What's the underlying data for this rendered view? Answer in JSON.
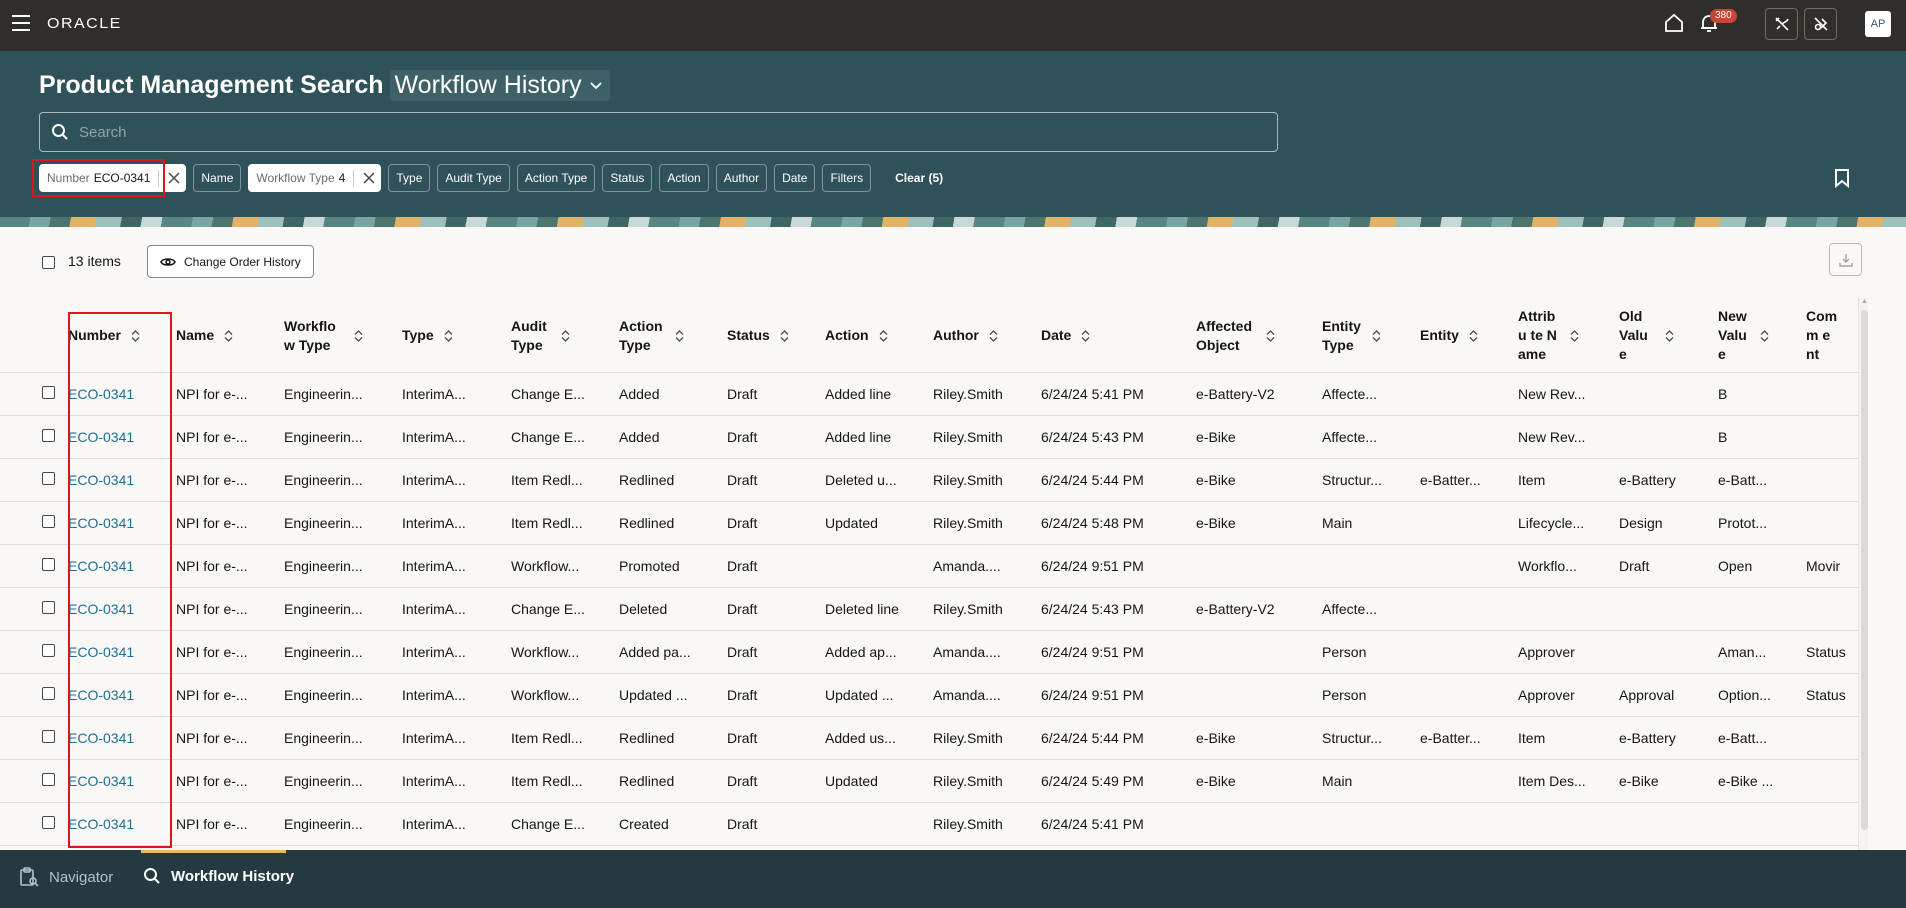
{
  "topbar": {
    "logo": "ORACLE",
    "notification_count": "380",
    "avatar_initials": "AP"
  },
  "header": {
    "title": "Product Management Search",
    "view_switcher": "Workflow History",
    "search_placeholder": "Search",
    "search_value": "",
    "chips": [
      {
        "label": "Number",
        "value": "ECO-0341",
        "active": true
      },
      {
        "label": "Name",
        "active": false
      },
      {
        "label": "Workflow Type",
        "value": "4",
        "active": true
      },
      {
        "label": "Type",
        "active": false
      },
      {
        "label": "Audit Type",
        "active": false
      },
      {
        "label": "Action Type",
        "active": false
      },
      {
        "label": "Status",
        "active": false
      },
      {
        "label": "Action",
        "active": false
      },
      {
        "label": "Author",
        "active": false
      },
      {
        "label": "Date",
        "active": false
      },
      {
        "label": "Filters",
        "active": false
      }
    ],
    "clear_label": "Clear (5)"
  },
  "toolbar": {
    "items_count": "13 items",
    "change_order_history_label": "Change Order History"
  },
  "table": {
    "columns": [
      {
        "key": "number",
        "label": "Number"
      },
      {
        "key": "name",
        "label": "Name"
      },
      {
        "key": "workflow_type",
        "label": "Workflow Type"
      },
      {
        "key": "type",
        "label": "Type"
      },
      {
        "key": "audit_type",
        "label": "Audit Type"
      },
      {
        "key": "action_type",
        "label": "Action Type"
      },
      {
        "key": "status",
        "label": "Status"
      },
      {
        "key": "action",
        "label": "Action"
      },
      {
        "key": "author",
        "label": "Author"
      },
      {
        "key": "date",
        "label": "Date"
      },
      {
        "key": "affected_object",
        "label": "Affected Object"
      },
      {
        "key": "entity_type",
        "label": "Entity Type"
      },
      {
        "key": "entity",
        "label": "Entity"
      },
      {
        "key": "attribute_name",
        "label": "Attribu te Name"
      },
      {
        "key": "old_value",
        "label": "Old Value"
      },
      {
        "key": "new_value",
        "label": "New Valu e"
      },
      {
        "key": "comment",
        "label": "Comm ent"
      }
    ],
    "rows": [
      [
        "ECO-0341",
        "NPI for e-...",
        "Engineerin...",
        "InterimA...",
        "Change E...",
        "Added",
        "Draft",
        "Added line",
        "Riley.Smith",
        "6/24/24 5:41 PM",
        "e-Battery-V2",
        "Affecte...",
        "",
        "New Rev...",
        "",
        "B",
        ""
      ],
      [
        "ECO-0341",
        "NPI for e-...",
        "Engineerin...",
        "InterimA...",
        "Change E...",
        "Added",
        "Draft",
        "Added line",
        "Riley.Smith",
        "6/24/24 5:43 PM",
        "e-Bike",
        "Affecte...",
        "",
        "New Rev...",
        "",
        "B",
        ""
      ],
      [
        "ECO-0341",
        "NPI for e-...",
        "Engineerin...",
        "InterimA...",
        "Item Redl...",
        "Redlined",
        "Draft",
        "Deleted u...",
        "Riley.Smith",
        "6/24/24 5:44 PM",
        "e-Bike",
        "Structur...",
        "e-Batter...",
        "Item",
        "e-Battery",
        "e-Batt...",
        ""
      ],
      [
        "ECO-0341",
        "NPI for e-...",
        "Engineerin...",
        "InterimA...",
        "Item Redl...",
        "Redlined",
        "Draft",
        "Updated",
        "Riley.Smith",
        "6/24/24 5:48 PM",
        "e-Bike",
        "Main",
        "",
        "Lifecycle...",
        "Design",
        "Protot...",
        ""
      ],
      [
        "ECO-0341",
        "NPI for e-...",
        "Engineerin...",
        "InterimA...",
        "Workflow...",
        "Promoted",
        "Draft",
        "",
        "Amanda....",
        "6/24/24 9:51 PM",
        "",
        "",
        "",
        "Workflo...",
        "Draft",
        "Open",
        "Movir"
      ],
      [
        "ECO-0341",
        "NPI for e-...",
        "Engineerin...",
        "InterimA...",
        "Change E...",
        "Deleted",
        "Draft",
        "Deleted line",
        "Riley.Smith",
        "6/24/24 5:43 PM",
        "e-Battery-V2",
        "Affecte...",
        "",
        "",
        "",
        "",
        ""
      ],
      [
        "ECO-0341",
        "NPI for e-...",
        "Engineerin...",
        "InterimA...",
        "Workflow...",
        "Added pa...",
        "Draft",
        "Added ap...",
        "Amanda....",
        "6/24/24 9:51 PM",
        "",
        "Person",
        "",
        "Approver",
        "",
        "Aman...",
        "Status"
      ],
      [
        "ECO-0341",
        "NPI for e-...",
        "Engineerin...",
        "InterimA...",
        "Workflow...",
        "Updated ...",
        "Draft",
        "Updated ...",
        "Amanda....",
        "6/24/24 9:51 PM",
        "",
        "Person",
        "",
        "Approver",
        "Approval",
        "Option...",
        "Status"
      ],
      [
        "ECO-0341",
        "NPI for e-...",
        "Engineerin...",
        "InterimA...",
        "Item Redl...",
        "Redlined",
        "Draft",
        "Added us...",
        "Riley.Smith",
        "6/24/24 5:44 PM",
        "e-Bike",
        "Structur...",
        "e-Batter...",
        "Item",
        "e-Battery",
        "e-Batt...",
        ""
      ],
      [
        "ECO-0341",
        "NPI for e-...",
        "Engineerin...",
        "InterimA...",
        "Item Redl...",
        "Redlined",
        "Draft",
        "Updated",
        "Riley.Smith",
        "6/24/24 5:49 PM",
        "e-Bike",
        "Main",
        "",
        "Item Des...",
        "e-Bike",
        "e-Bike ...",
        ""
      ],
      [
        "ECO-0341",
        "NPI for e-...",
        "Engineerin...",
        "InterimA...",
        "Change E...",
        "Created",
        "Draft",
        "",
        "Riley.Smith",
        "6/24/24 5:41 PM",
        "",
        "",
        "",
        "",
        "",
        "",
        ""
      ]
    ]
  },
  "bottombar": {
    "navigator_label": "Navigator",
    "workflow_history_label": "Workflow History"
  },
  "colors": {
    "topbar": "#312d2a",
    "header": "#2f5159",
    "link": "#1d6f92",
    "highlight": "#e0141b",
    "badge": "#c74634",
    "bottombar": "#243a40",
    "active_tab_indicator": "#e5bd5a"
  }
}
